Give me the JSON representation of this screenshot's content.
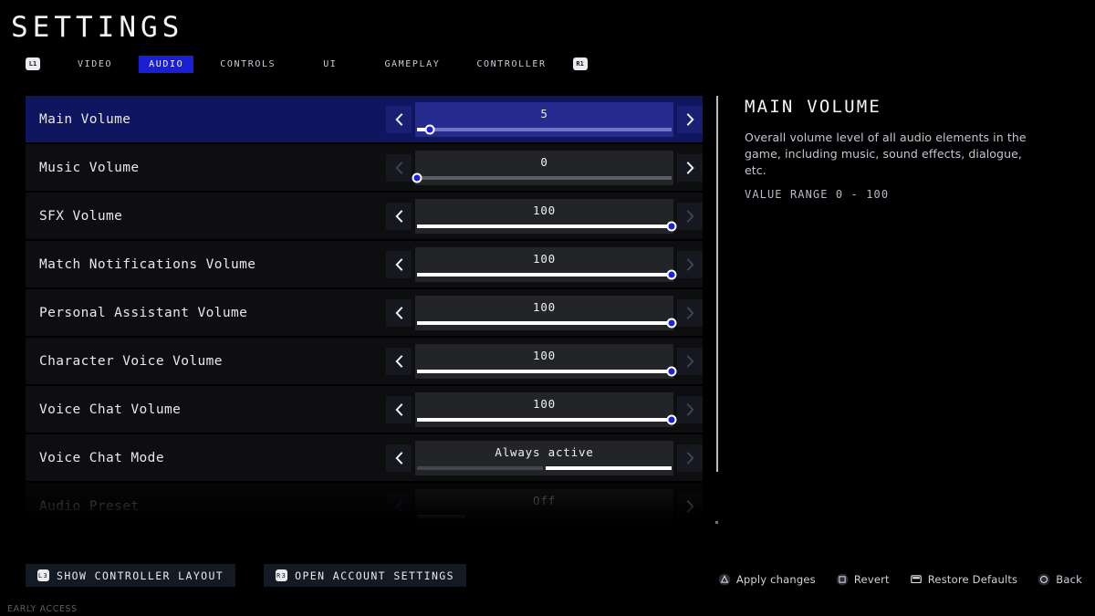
{
  "header": {
    "title": "SETTINGS",
    "left_bumper": "L1",
    "right_bumper": "R1",
    "tabs": [
      {
        "label": "VIDEO",
        "active": false
      },
      {
        "label": "AUDIO",
        "active": true
      },
      {
        "label": "CONTROLS",
        "active": false
      },
      {
        "label": "UI",
        "active": false
      },
      {
        "label": "GAMEPLAY",
        "active": false
      },
      {
        "label": "CONTROLLER",
        "active": false
      }
    ]
  },
  "settings": {
    "rows": [
      {
        "label": "Main Volume",
        "value": "5",
        "type": "slider",
        "percent": 5,
        "selected": true,
        "faded": false,
        "left_dim": false,
        "right_dim": false
      },
      {
        "label": "Music Volume",
        "value": "0",
        "type": "slider",
        "percent": 0,
        "selected": false,
        "faded": false,
        "left_dim": true,
        "right_dim": false
      },
      {
        "label": "SFX Volume",
        "value": "100",
        "type": "slider",
        "percent": 100,
        "selected": false,
        "faded": false,
        "left_dim": false,
        "right_dim": true
      },
      {
        "label": "Match Notifications Volume",
        "value": "100",
        "type": "slider",
        "percent": 100,
        "selected": false,
        "faded": false,
        "left_dim": false,
        "right_dim": true
      },
      {
        "label": "Personal Assistant Volume",
        "value": "100",
        "type": "slider",
        "percent": 100,
        "selected": false,
        "faded": false,
        "left_dim": false,
        "right_dim": true
      },
      {
        "label": "Character Voice Volume",
        "value": "100",
        "type": "slider",
        "percent": 100,
        "selected": false,
        "faded": false,
        "left_dim": false,
        "right_dim": true
      },
      {
        "label": "Voice Chat Volume",
        "value": "100",
        "type": "slider",
        "percent": 100,
        "selected": false,
        "faded": false,
        "left_dim": false,
        "right_dim": true
      },
      {
        "label": "Voice Chat Mode",
        "value": "Always active",
        "type": "segmented",
        "segments": 2,
        "active_segment": 2,
        "selected": false,
        "faded": false,
        "left_dim": false,
        "right_dim": true
      },
      {
        "label": "Audio Preset",
        "value": "Off",
        "type": "segmented",
        "segments": 5,
        "active_segment": 1,
        "selected": false,
        "faded": true,
        "left_dim": true,
        "right_dim": false
      }
    ]
  },
  "info_panel": {
    "title": "MAIN VOLUME",
    "description": "Overall volume level of all audio elements in the game, including music, sound effects, dialogue, etc.",
    "value_range": "VALUE RANGE 0 - 100"
  },
  "bottom_buttons": [
    {
      "label": "SHOW CONTROLLER LAYOUT",
      "icon": "L3"
    },
    {
      "label": "OPEN ACCOUNT SETTINGS",
      "icon": "R3"
    }
  ],
  "bottom_hints": [
    {
      "label": "Apply changes",
      "icon": "triangle"
    },
    {
      "label": "Revert",
      "icon": "square"
    },
    {
      "label": "Restore Defaults",
      "icon": "touchpad"
    },
    {
      "label": "Back",
      "icon": "circle"
    }
  ],
  "footer": {
    "early_access": "EARLY ACCESS"
  },
  "colors": {
    "accent_blue": "#1b1fd4",
    "selected_row": "#101560",
    "row_background": "#0e0e10",
    "knob": "#1f21d8"
  }
}
